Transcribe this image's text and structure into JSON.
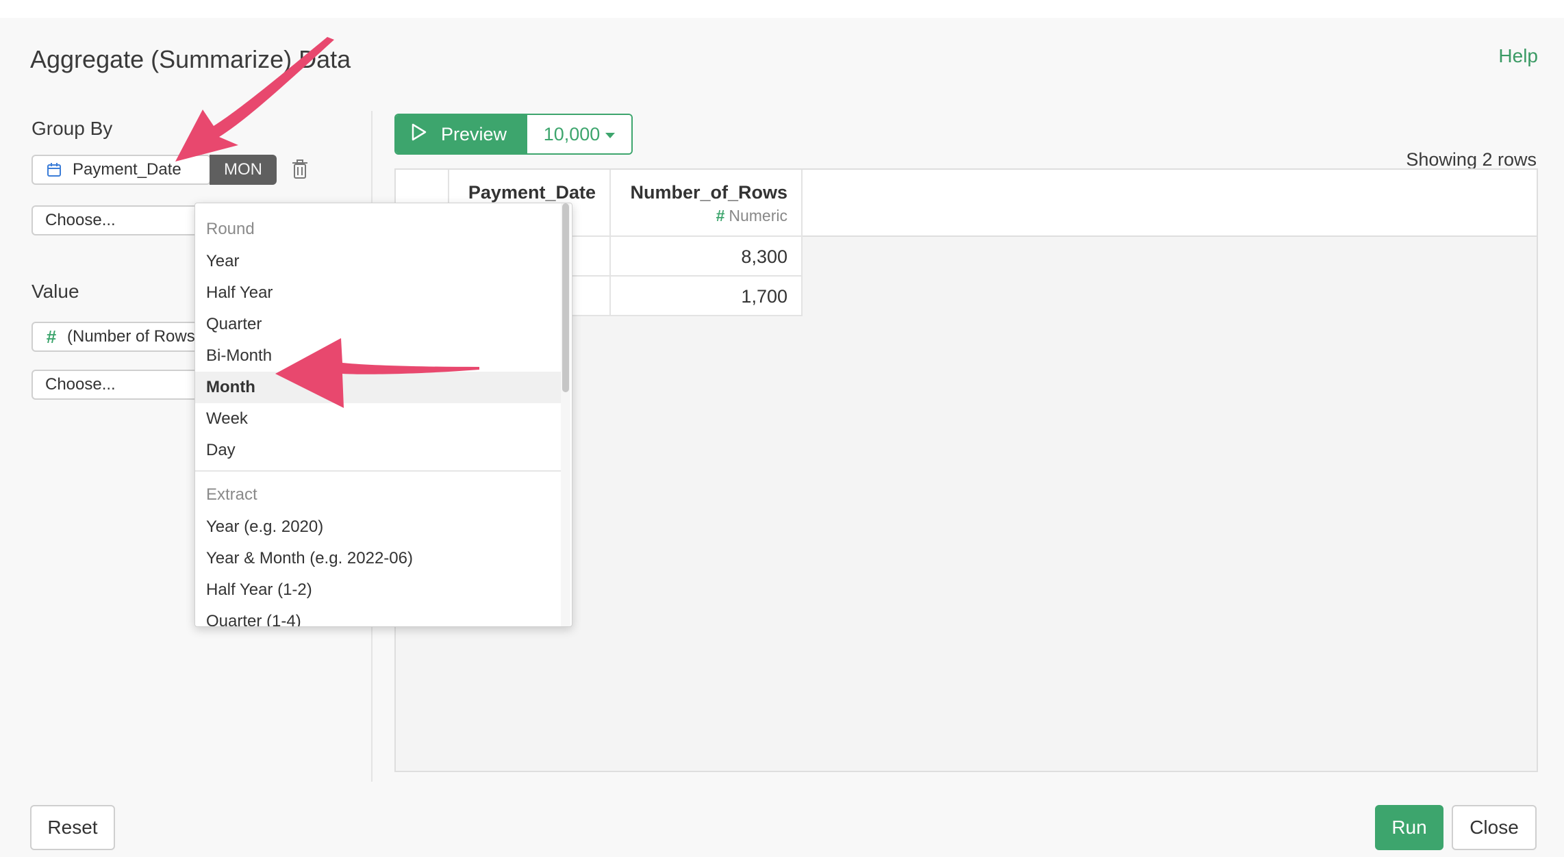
{
  "dialog": {
    "title": "Aggregate (Summarize) Data",
    "help_label": "Help"
  },
  "group_by": {
    "label": "Group By",
    "column_name": "Payment_Date",
    "column_icon": "calendar-icon",
    "rounding_tag": "MON",
    "choose_placeholder": "Choose..."
  },
  "value": {
    "label": "Value",
    "column_name": "(Number of Rows)",
    "column_icon": "hash-icon",
    "choose_placeholder": "Choose..."
  },
  "toolbar": {
    "preview_label": "Preview",
    "row_limit": "10,000",
    "showing_text": "Showing 2 rows"
  },
  "table": {
    "columns": [
      {
        "name": "Payment_Date",
        "type": ""
      },
      {
        "name": "Number_of_Rows",
        "type": "Numeric"
      }
    ],
    "rows": [
      {
        "number_of_rows": "8,300"
      },
      {
        "number_of_rows": "1,700"
      }
    ]
  },
  "dropdown": {
    "round_header": "Round",
    "round_items": [
      "Year",
      "Half Year",
      "Quarter",
      "Bi-Month",
      "Month",
      "Week",
      "Day"
    ],
    "selected": "Month",
    "extract_header": "Extract",
    "extract_items": [
      "Year (e.g. 2020)",
      "Year & Month (e.g. 2022-06)",
      "Half Year (1-2)",
      "Quarter (1-4)"
    ]
  },
  "footer": {
    "reset_label": "Reset",
    "run_label": "Run",
    "close_label": "Close"
  },
  "colors": {
    "accent_green": "#3da56d",
    "annotation_pink": "#e8486e",
    "tag_gray": "#5f5f5f"
  }
}
